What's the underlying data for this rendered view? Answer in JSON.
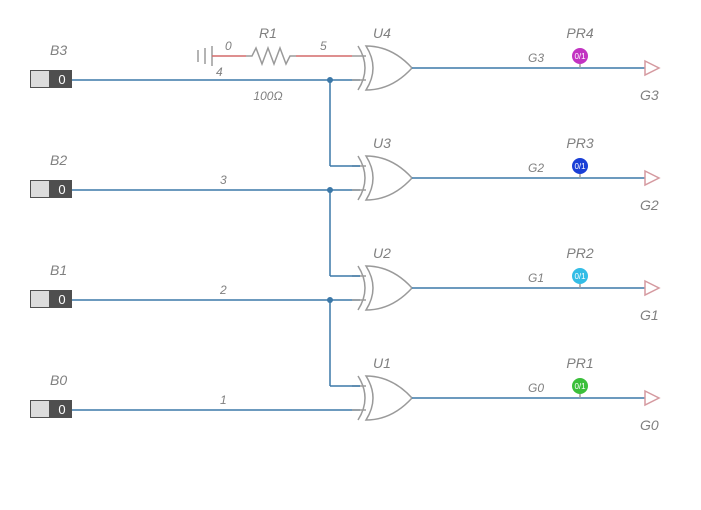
{
  "inputs": [
    {
      "label": "B3",
      "value": "0",
      "net": "4"
    },
    {
      "label": "B2",
      "value": "0",
      "net": "3"
    },
    {
      "label": "B1",
      "value": "0",
      "net": "2"
    },
    {
      "label": "B0",
      "value": "0",
      "net": "1"
    }
  ],
  "gates": [
    {
      "ref": "U4",
      "out_net": "G3",
      "out_label": "G3"
    },
    {
      "ref": "U3",
      "out_net": "G2",
      "out_label": "G2"
    },
    {
      "ref": "U2",
      "out_net": "G1",
      "out_label": "G1"
    },
    {
      "ref": "U1",
      "out_net": "G0",
      "out_label": "G0"
    }
  ],
  "resistor": {
    "ref": "R1",
    "value": "100Ω",
    "net_left": "0",
    "net_right": "5"
  },
  "probes": [
    {
      "ref": "PR4",
      "badge": "0/1",
      "color": "#c233c2"
    },
    {
      "ref": "PR3",
      "badge": "0/1",
      "color": "#1a3fd6"
    },
    {
      "ref": "PR2",
      "badge": "0/1",
      "color": "#33bde6"
    },
    {
      "ref": "PR1",
      "badge": "0/1",
      "color": "#3bbf3b"
    }
  ]
}
